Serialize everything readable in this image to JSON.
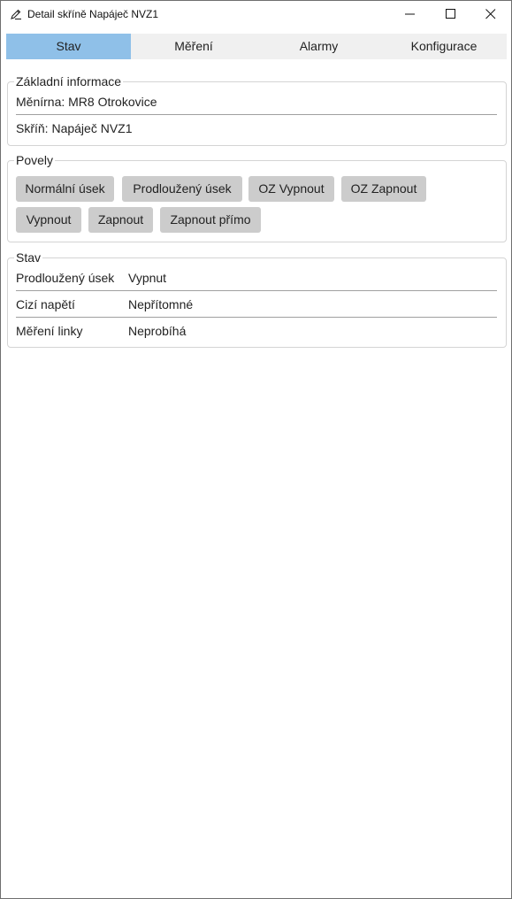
{
  "window": {
    "title": "Detail skříně Napáječ NVZ1",
    "app_icon": "pen-edit-icon",
    "controls": {
      "minimize": "minimize-icon",
      "maximize": "maximize-icon",
      "close": "close-icon"
    }
  },
  "tabs": [
    {
      "label": "Stav",
      "active": true
    },
    {
      "label": "Měření",
      "active": false
    },
    {
      "label": "Alarmy",
      "active": false
    },
    {
      "label": "Konfigurace",
      "active": false
    }
  ],
  "basic_info": {
    "legend": "Základní informace",
    "substation": "Měnírna: MR8 Otrokovice",
    "cabinet": "Skříň: Napáječ NVZ1"
  },
  "commands": {
    "legend": "Povely",
    "buttons": [
      "Normální úsek",
      "Prodloužený úsek",
      "OZ Vypnout",
      "OZ Zapnout",
      "Vypnout",
      "Zapnout",
      "Zapnout přímo"
    ]
  },
  "state": {
    "legend": "Stav",
    "rows": [
      {
        "label": "Prodloužený úsek",
        "value": "Vypnut"
      },
      {
        "label": "Cizí napětí",
        "value": "Nepřítomné"
      },
      {
        "label": "Měření linky",
        "value": "Neprobíhá"
      }
    ]
  },
  "colors": {
    "active_tab": "#8fc0e8",
    "tab_bar": "#f0f0f0",
    "button_bg": "#cccccc",
    "group_border": "#d4d4d4"
  }
}
